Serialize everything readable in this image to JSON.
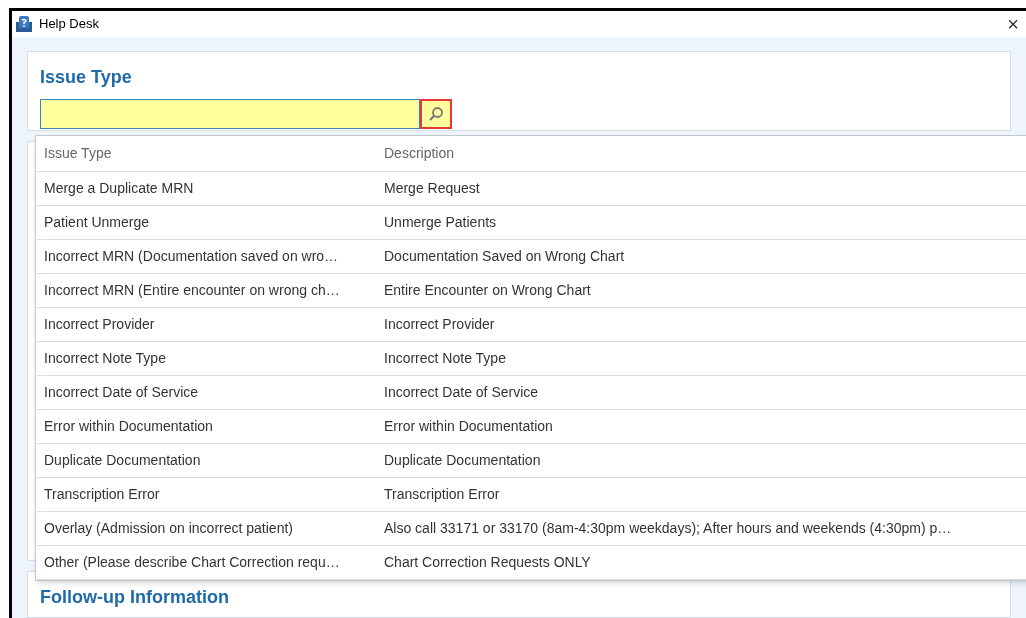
{
  "window": {
    "title": "Help Desk",
    "close": "×"
  },
  "issue_section": {
    "heading": "Issue Type"
  },
  "dropdown": {
    "columns": [
      "Issue Type",
      "Description"
    ],
    "rows": [
      {
        "cells": [
          "Merge a Duplicate MRN",
          "Merge Request"
        ]
      },
      {
        "cells": [
          "Patient Unmerge",
          "Unmerge Patients"
        ]
      },
      {
        "cells": [
          "Incorrect MRN (Documentation saved on wro…",
          "Documentation Saved on Wrong Chart"
        ]
      },
      {
        "cells": [
          "Incorrect MRN (Entire encounter on wrong ch…",
          "Entire Encounter on Wrong Chart"
        ]
      },
      {
        "cells": [
          "Incorrect Provider",
          "Incorrect Provider"
        ]
      },
      {
        "cells": [
          "Incorrect Note Type",
          "Incorrect Note Type"
        ]
      },
      {
        "cells": [
          "Incorrect Date of Service",
          "Incorrect Date of Service"
        ]
      },
      {
        "cells": [
          "Error within Documentation",
          "Error within Documentation"
        ]
      },
      {
        "cells": [
          "Duplicate Documentation",
          "Duplicate Documentation"
        ]
      },
      {
        "cells": [
          "Transcription Error",
          "Transcription Error"
        ]
      },
      {
        "cells": [
          "Overlay (Admission on incorrect patient)",
          "Also call 33171 or 33170 (8am-4:30pm weekdays); After hours and weekends (4:30pm) p…"
        ]
      },
      {
        "cells": [
          "Other (Please describe Chart Correction requ…",
          "Chart Correction Requests ONLY"
        ]
      }
    ]
  },
  "followup_section": {
    "heading": "Follow-up Information"
  }
}
